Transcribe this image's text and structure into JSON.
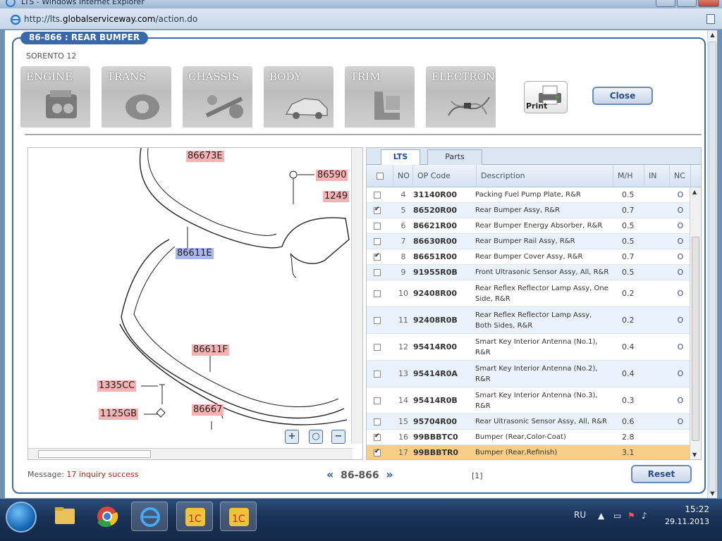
{
  "browser": {
    "title": "LTS - Windows Internet Explorer",
    "url_prefix": "http://lts.",
    "url_domain": "globalserviceway.com",
    "url_path": "/action.do"
  },
  "panel": {
    "title": "86-866 : REAR BUMPER",
    "model": "SORENTO 12"
  },
  "categories": [
    {
      "label": "ENGINE"
    },
    {
      "label": "TRANS"
    },
    {
      "label": "CHASSIS"
    },
    {
      "label": "BODY"
    },
    {
      "label": "TRIM"
    },
    {
      "label": "ELECTRONIC"
    }
  ],
  "toolbar": {
    "print_label": "Print",
    "close_label": "Close"
  },
  "diagram": {
    "labels": [
      {
        "text": "86673E",
        "style": "r"
      },
      {
        "text": "86590",
        "style": "r"
      },
      {
        "text": "1249",
        "style": "r"
      },
      {
        "text": "86611E",
        "style": "b"
      },
      {
        "text": "86611F",
        "style": "r"
      },
      {
        "text": "1335CC",
        "style": "r"
      },
      {
        "text": "1125GB",
        "style": "r"
      },
      {
        "text": "86667",
        "style": "r"
      }
    ]
  },
  "tabs": [
    {
      "label": "LTS",
      "active": true
    },
    {
      "label": "Parts",
      "active": false
    }
  ],
  "columns": {
    "no": "NO",
    "op": "OP Code",
    "desc": "Description",
    "mh": "M/H",
    "in": "IN",
    "nc": "NC"
  },
  "rows": [
    {
      "no": "4",
      "op": "31140R00",
      "desc": "Packing Fuel Pump Plate, R&R",
      "mh": "0.5",
      "nc": "O",
      "checked": false
    },
    {
      "no": "5",
      "op": "86520R00",
      "desc": "Rear Bumper Assy, R&R",
      "mh": "0.7",
      "nc": "O",
      "checked": true
    },
    {
      "no": "6",
      "op": "86621R00",
      "desc": "Rear Bumper Energy Absorber, R&R",
      "mh": "0.5",
      "nc": "O",
      "checked": false
    },
    {
      "no": "7",
      "op": "86630R00",
      "desc": "Rear Bumper Rail Assy, R&R",
      "mh": "0.5",
      "nc": "O",
      "checked": false
    },
    {
      "no": "8",
      "op": "86651R00",
      "desc": "Rear Bumper Cover Assy, R&R",
      "mh": "0.7",
      "nc": "O",
      "checked": true
    },
    {
      "no": "9",
      "op": "91955R0B",
      "desc": "Front Ultrasonic Sensor Assy, All, R&R",
      "mh": "0.5",
      "nc": "O",
      "checked": false
    },
    {
      "no": "10",
      "op": "92408R00",
      "desc": "Rear Reflex Reflector Lamp Assy, One Side, R&R",
      "mh": "0.2",
      "nc": "O",
      "checked": false
    },
    {
      "no": "11",
      "op": "92408R0B",
      "desc": "Rear Reflex Reflector Lamp Assy, Both Sides, R&R",
      "mh": "0.2",
      "nc": "O",
      "checked": false
    },
    {
      "no": "12",
      "op": "95414R00",
      "desc": "Smart Key Interior Antenna (No.1), R&R",
      "mh": "0.4",
      "nc": "O",
      "checked": false
    },
    {
      "no": "13",
      "op": "95414R0A",
      "desc": "Smart Key Interior Antenna (No.2), R&R",
      "mh": "0.4",
      "nc": "O",
      "checked": false
    },
    {
      "no": "14",
      "op": "95414R0B",
      "desc": "Smart Key Interior Antenna (No.3), R&R",
      "mh": "0.3",
      "nc": "O",
      "checked": false
    },
    {
      "no": "15",
      "op": "95704R00",
      "desc": "Rear Ultrasonic Sensor Assy, All, R&R",
      "mh": "0.6",
      "nc": "O",
      "checked": false
    },
    {
      "no": "16",
      "op": "99BBBTC0",
      "desc": "Bumper (Rear,Color-Coat)",
      "mh": "2.8",
      "nc": "",
      "checked": true
    },
    {
      "no": "17",
      "op": "99BBBTR0",
      "desc": "Bumper (Rear,Refinish)",
      "mh": "3.1",
      "nc": "",
      "checked": true,
      "selected": true
    }
  ],
  "footer": {
    "message_label": "Message:",
    "message_text": "17 inquiry success",
    "prev": "«",
    "code": "86-866",
    "next": "»",
    "page": "[1]",
    "reset_label": "Reset"
  },
  "taskbar": {
    "lang": "RU",
    "time": "15:22",
    "date": "29.11.2013"
  }
}
